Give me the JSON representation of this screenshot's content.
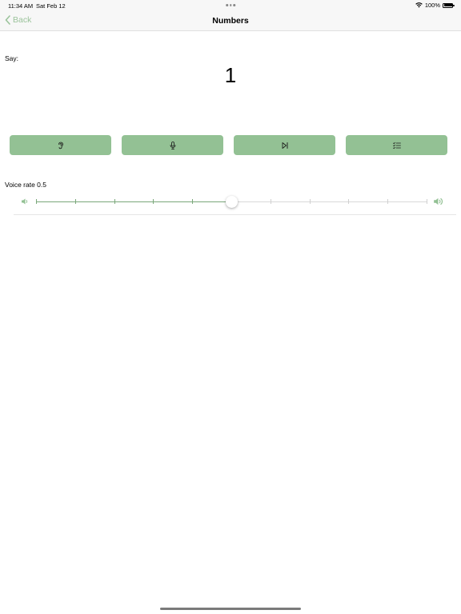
{
  "status_bar": {
    "time": "11:34 AM",
    "date": "Sat Feb 12",
    "battery": "100%"
  },
  "nav": {
    "back_label": "Back",
    "title": "Numbers"
  },
  "content": {
    "say_label": "Say:",
    "number": "1",
    "voice_rate_label": "Voice rate 0.5"
  },
  "buttons": {
    "listen_icon": "ear-icon",
    "record_icon": "microphone-icon",
    "next_icon": "skip-forward-icon",
    "list_icon": "checklist-icon"
  },
  "slider": {
    "min": 0,
    "max": 1,
    "value": 0.5,
    "ticks": 10
  },
  "colors": {
    "accent": "#9bc39b",
    "button_bg": "#93c194",
    "track_fill": "#7aa87a"
  }
}
